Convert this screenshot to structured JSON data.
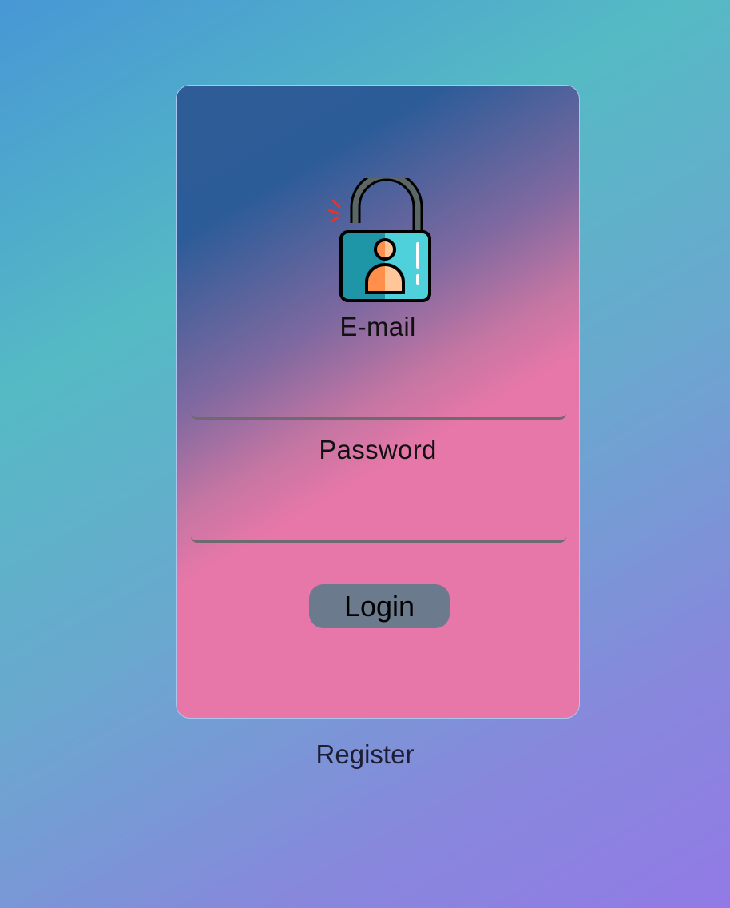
{
  "login_form": {
    "icon": "unlocked-padlock-user-icon",
    "email_label": "E-mail",
    "email_value": "",
    "password_label": "Password",
    "password_value": "",
    "login_button": "Login"
  },
  "register_link": "Register",
  "colors": {
    "card_top": "#2c5c98",
    "card_bottom": "#e777a9",
    "button_bg": "#6b7a8c",
    "background_start": "#4797d5",
    "background_end": "#927ae6"
  }
}
